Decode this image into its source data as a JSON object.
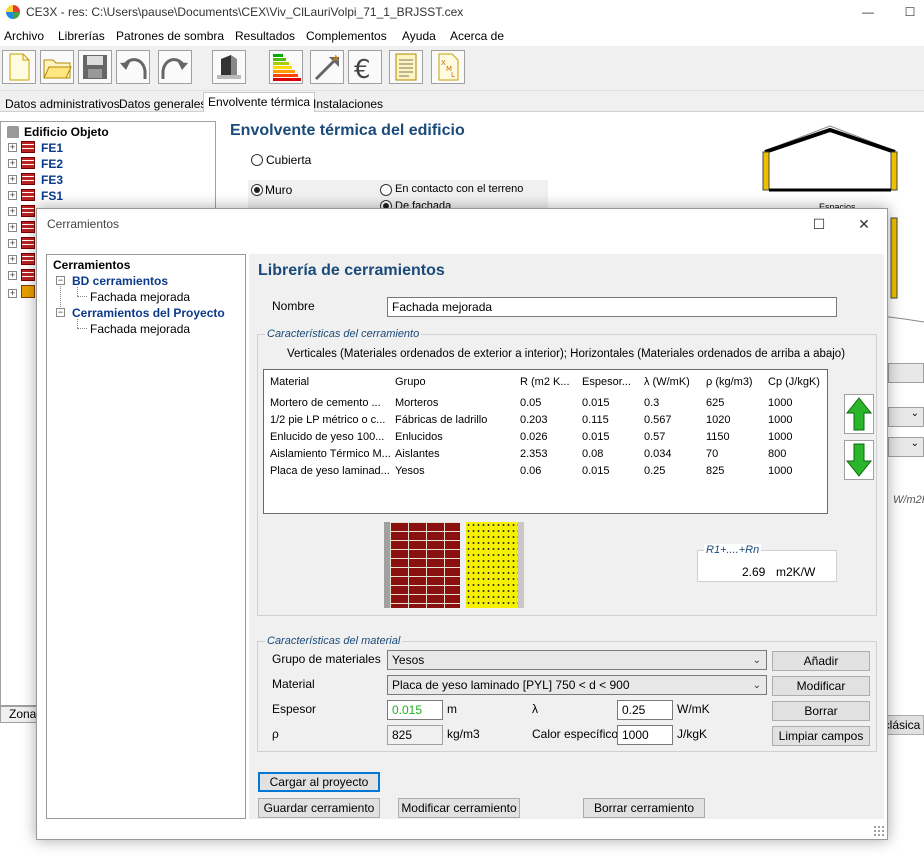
{
  "window": {
    "title": "CE3X - res: C:\\Users\\pause\\Documents\\CEX\\Viv_ClLauriVolpi_71_1_BRJSST.cex",
    "minimize": "—",
    "maximize": "☐"
  },
  "menu": [
    "Archivo",
    "Librerías",
    "Patrones de sombra",
    "Resultados",
    "Complementos",
    "Ayuda",
    "Acerca de"
  ],
  "toolbar": [
    "new-file-icon",
    "open-folder-icon",
    "save-disk-icon",
    "undo-icon",
    "redo-icon",
    "building-block-icon",
    "energy-rating-icon",
    "improvement-arrow-icon",
    "euro-icon",
    "report-icon",
    "xml-export-icon"
  ],
  "tabs": [
    "Datos administrativos",
    "Datos generales",
    "Envolvente térmica",
    "Instalaciones"
  ],
  "background": {
    "tree_root": "Edificio Objeto",
    "tree_items": [
      "FE1",
      "FE2",
      "FE3",
      "FS1"
    ],
    "heading": "Envolvente térmica del edificio",
    "radio_cubierta": "Cubierta",
    "radio_muro": "Muro",
    "radio_terreno": "En contacto con el terreno",
    "radio_fachada": "De fachada",
    "espacios": "Espacios",
    "zonas_tab": "Zonas",
    "clasica_btn": "clásica",
    "unit_hint": "W/m2K"
  },
  "dialog": {
    "title": "Cerramientos",
    "tree": {
      "root": "Cerramientos",
      "bd_label": "BD cerramientos",
      "bd_child": "Fachada mejorada",
      "proj_label": "Cerramientos del Proyecto",
      "proj_child": "Fachada mejorada"
    },
    "heading": "Librería de cerramientos",
    "nombre_label": "Nombre",
    "nombre_value": "Fachada mejorada",
    "car_cerr_label": "Características del cerramiento",
    "orden_text": "Verticales (Materiales ordenados de exterior a interior);  Horizontales (Materiales ordenados de arriba a abajo)",
    "table": {
      "headers": [
        "Material",
        "Grupo",
        "R (m2 K...",
        "Espesor...",
        "λ (W/mK)",
        "ρ (kg/m3)",
        "Cp (J/kgK)"
      ],
      "rows": [
        [
          "Mortero de cemento ...",
          "Morteros",
          "0.05",
          "0.015",
          "0.3",
          "625",
          "1000"
        ],
        [
          "1/2 pie LP métrico o c...",
          "Fábricas de ladrillo",
          "0.203",
          "0.115",
          "0.567",
          "1020",
          "1000"
        ],
        [
          "Enlucido de yeso 100...",
          "Enlucidos",
          "0.026",
          "0.015",
          "0.57",
          "1150",
          "1000"
        ],
        [
          "Aislamiento Térmico M...",
          "Aislantes",
          "2.353",
          "0.08",
          "0.034",
          "70",
          "800"
        ],
        [
          "Placa de yeso laminad...",
          "Yesos",
          "0.06",
          "0.015",
          "0.25",
          "825",
          "1000"
        ]
      ]
    },
    "rsum_label": "R1+....+Rn",
    "rsum_value": "2.69",
    "rsum_unit": "m2K/W",
    "car_mat_label": "Características del material",
    "grupo_label": "Grupo de materiales",
    "grupo_value": "Yesos",
    "material_label": "Material",
    "material_value": "Placa de yeso laminado [PYL] 750 < d < 900",
    "espesor_label": "Espesor",
    "espesor_value": "0.015",
    "espesor_unit": "m",
    "lambda_label": "λ",
    "lambda_value": "0.25",
    "lambda_unit": "W/mK",
    "rho_label": "ρ",
    "rho_value": "825",
    "rho_unit": "kg/m3",
    "calor_label": "Calor específico",
    "calor_value": "1000",
    "calor_unit": "J/kgK",
    "btn_anadir": "Añadir",
    "btn_modificar": "Modificar",
    "btn_borrar": "Borrar",
    "btn_limpiar": "Limpiar campos",
    "btn_cargar": "Cargar al proyecto",
    "btn_guardar": "Guardar cerramiento",
    "btn_mod_cerr": "Modificar cerramiento",
    "btn_borrar_cerr": "Borrar cerramiento"
  }
}
